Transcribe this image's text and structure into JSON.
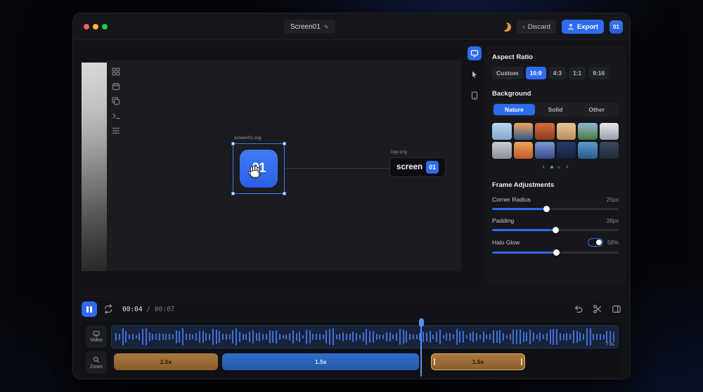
{
  "titlebar": {
    "title": "Screen01",
    "edit_icon": "✎",
    "chevron": "‹",
    "discard": "Discard",
    "export": "Export",
    "logo": "01"
  },
  "canvas": {
    "selection_label": "screen01.svg",
    "app_icon_text": "01",
    "logo_label": "logo.png",
    "logo_text": "screen",
    "logo_badge": "01"
  },
  "panel": {
    "aspect_title": "Aspect Ratio",
    "aspect_options": [
      "Custom",
      "16:9",
      "4:3",
      "1:1",
      "9:16"
    ],
    "aspect_selected": "16:9",
    "background_title": "Background",
    "background_tabs": [
      "Nature",
      "Solid",
      "Other"
    ],
    "background_selected": "Nature",
    "thumbnails": [
      [
        "#bcd7ee",
        "#7fa8cf"
      ],
      [
        "#f2a45c",
        "#355a88"
      ],
      [
        "#d96c3a",
        "#8a3e22"
      ],
      [
        "#e8c89a",
        "#b98d5a"
      ],
      [
        "#8fb8d8",
        "#4a7a3a"
      ],
      [
        "#e8e8ea",
        "#9aa0a8"
      ],
      [
        "#c8ccd2",
        "#8a9098"
      ],
      [
        "#f0a05a",
        "#c05a2a"
      ],
      [
        "#7a9ad0",
        "#3a4a88"
      ],
      [
        "#2a3a6a",
        "#16203f"
      ],
      [
        "#5a9ad0",
        "#2a5a8a"
      ],
      [
        "#3a4a5a",
        "#202a36"
      ]
    ],
    "pager": {
      "dots": 2,
      "active": 0,
      "prev": "‹",
      "next": "›"
    },
    "frame_title": "Frame Adjustments",
    "sliders": [
      {
        "label": "Corner Radius",
        "value": "25px",
        "percent": 43,
        "toggle": false
      },
      {
        "label": "Padding",
        "value": "38px",
        "percent": 50,
        "toggle": false
      },
      {
        "label": "Halo Glow",
        "value": "58%",
        "percent": 51,
        "toggle": true
      }
    ]
  },
  "timeline": {
    "time_current": "00:04",
    "time_separator": " / ",
    "time_total": "00:07",
    "track_labels": [
      "Video",
      "Zoom"
    ],
    "duration": "7.9s",
    "playhead_percent": 61,
    "segments": [
      {
        "label": "2.0x",
        "color": "tan",
        "left": 0.5,
        "width": 20.6,
        "selected": false
      },
      {
        "label": "1.5x",
        "color": "blue",
        "left": 21.9,
        "width": 38.8,
        "selected": false
      },
      {
        "label": "1.5x",
        "color": "tan",
        "left": 63.0,
        "width": 18.6,
        "selected": true
      }
    ],
    "waveform": {
      "bars": 150,
      "seed": 7
    }
  },
  "colors": {
    "accent": "#2e6bf0",
    "tan": "#9a6a33",
    "blue_segment": "#2d66c0",
    "waveform": "#3d6fd6"
  }
}
